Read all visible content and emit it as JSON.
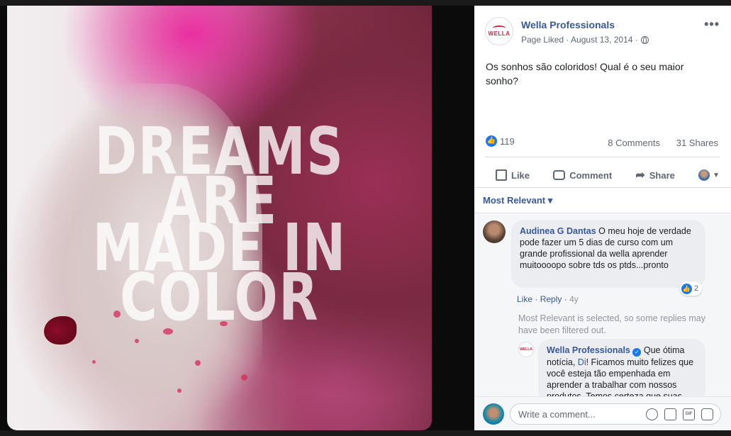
{
  "photo": {
    "text_lines": [
      "DREAMS",
      "ARE",
      "MADE IN",
      "COLOR"
    ]
  },
  "post": {
    "page_name": "Wella Professionals",
    "meta": "Page Liked · August 13, 2014 ·",
    "logo_text": "WELLA",
    "body": "Os sonhos são coloridos! Qual é o seu maior sonho?",
    "reaction_count": "119",
    "comments_count": "8 Comments",
    "shares_count": "31 Shares",
    "actions": {
      "like": "Like",
      "comment": "Comment",
      "share": "Share"
    },
    "sort_label": "Most Relevant ▾"
  },
  "comments": [
    {
      "author": "Audinea G Dantas",
      "text": "O meu hoje de verdade pode fazer um 5 dias de curso com um grande profissional da wella aprender muitoooopo sobre tds os ptds...pronto",
      "like": "Like",
      "reply": "Reply",
      "age": "4y",
      "reactions": "2"
    }
  ],
  "filter_note": "Most Relevant is selected, so some replies may have been filtered out.",
  "reply": {
    "author": "Wella Professionals",
    "logo_text": "WELLA",
    "text_before": "Que ótima notícia,",
    "mention": "Di",
    "text_after": "! Ficamos muito felizes que você esteja tão empenhada em aprender a trabalhar com nossos produtos. Temos certeza que suas"
  },
  "composer": {
    "placeholder": "Write a comment..."
  },
  "colors": {
    "link": "#385898",
    "accent": "#1877f2",
    "brand": "#d81f3c"
  }
}
